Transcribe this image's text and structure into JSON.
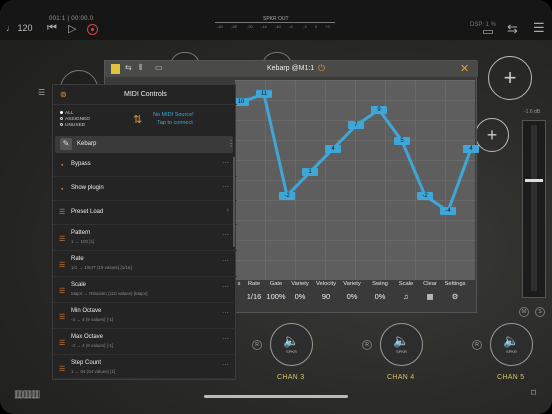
{
  "transport": {
    "tempo": "♩ 120",
    "time": "001:1 | 00:00.0"
  },
  "meter": {
    "label": "SPKR OUT",
    "ticks": [
      "-40",
      "-28",
      "-20",
      "-14",
      "-10",
      "-6",
      "-3",
      "0",
      "+3"
    ]
  },
  "dsp": "DSP: 1 %",
  "midi": {
    "title": "MIDI Controls",
    "filters": [
      "ALL",
      "ASSIGNED",
      "UNUSED"
    ],
    "source_title": "No MIDI Source!",
    "source_sub": "Tap to connect",
    "plugin_name": "Kebarp",
    "rows": [
      {
        "title": "Bypass",
        "sub": ""
      },
      {
        "title": "Show plugin",
        "sub": ""
      },
      {
        "title": "Preset Load",
        "sub": ""
      },
      {
        "title": "Pattern",
        "sub": "1 → 100 [1]"
      },
      {
        "title": "Rate",
        "sub": "1/1 → 1/64T (19 values) [1/16]"
      },
      {
        "title": "Scale",
        "sub": "Major → Ritsusen (110 values) [Major]"
      },
      {
        "title": "Min Octave",
        "sub": "-4 → 4 (9 values) [-1]"
      },
      {
        "title": "Max Octave",
        "sub": "-4 → 4 (9 values) [-1]"
      },
      {
        "title": "Step Count",
        "sub": "1 → 64 (64 values) [1]"
      }
    ]
  },
  "kebarp": {
    "title": "Kebarp @M1:1"
  },
  "steps": [
    {
      "value": "10",
      "level": 10
    },
    {
      "value": "11",
      "level": 11
    },
    {
      "value": "-2",
      "level": -2
    },
    {
      "value": "1",
      "level": 1
    },
    {
      "value": "4",
      "level": 4
    },
    {
      "value": "7",
      "level": 7
    },
    {
      "value": "9",
      "level": 9
    },
    {
      "value": "5",
      "level": 5
    },
    {
      "value": "-2",
      "level": -2
    },
    {
      "value": "-4",
      "level": -4
    },
    {
      "value": "4",
      "level": 4
    }
  ],
  "params": [
    {
      "h": "s",
      "v": ""
    },
    {
      "h": "Rate",
      "v": "1/16"
    },
    {
      "h": "Gate",
      "v": "100%"
    },
    {
      "h": "Variety",
      "v": "0%"
    },
    {
      "h": "Velocity",
      "v": "90"
    },
    {
      "h": "Variety",
      "v": "0%"
    },
    {
      "h": "Swing",
      "v": "0%"
    },
    {
      "h": "Scale",
      "v": "♫"
    },
    {
      "h": "Clear",
      "v": "▦"
    },
    {
      "h": "Settings",
      "v": "⚙"
    }
  ],
  "channels": [
    {
      "name": "CHAN 3",
      "spkr": "SPKR"
    },
    {
      "name": "CHAN 4",
      "spkr": "SPKR"
    },
    {
      "name": "CHAN 5",
      "spkr": "SPKR"
    }
  ],
  "fader_db": "-1.6 dB",
  "ms": {
    "m": "M",
    "s": "S"
  },
  "r_label": "R"
}
